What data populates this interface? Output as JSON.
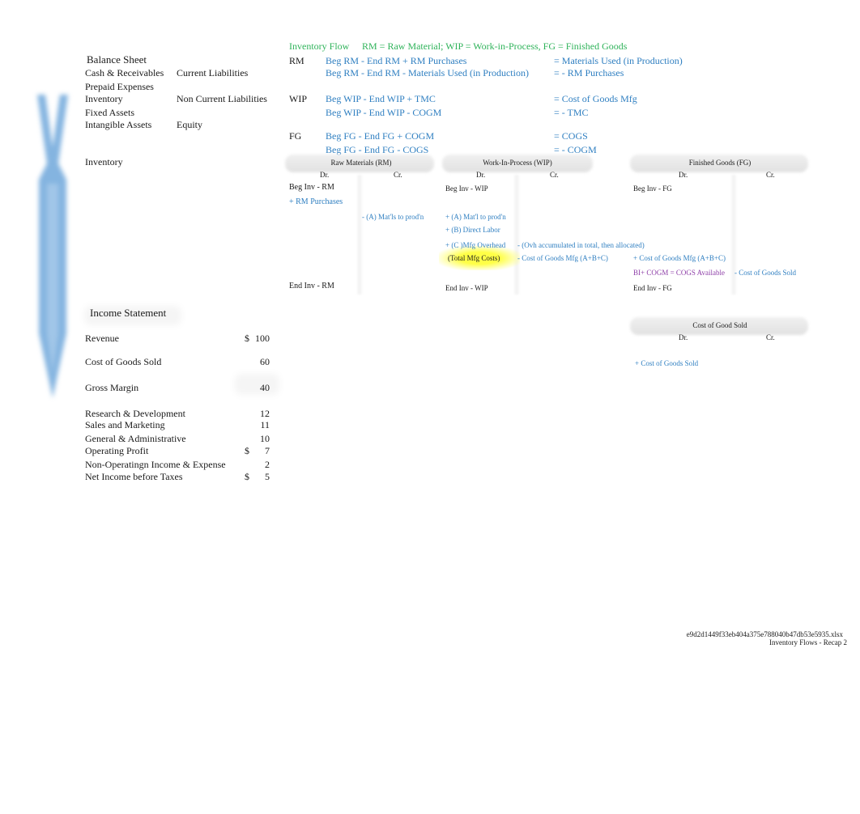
{
  "balance_sheet": {
    "title": "Balance Sheet",
    "assets": [
      "Cash & Receivables",
      "Prepaid Expenses",
      "Inventory",
      "Fixed Assets",
      "Intangible Assets"
    ],
    "liabilities": [
      "Current Liabilities",
      "Non Current Liabilities",
      "Equity"
    ],
    "inventory_label": "Inventory"
  },
  "inventory_flow": {
    "title": "Inventory Flow",
    "legend": "RM = Raw Material; WIP = Work-in-Process, FG = Finished Goods",
    "rows": [
      {
        "label": "RM",
        "formula": "Beg RM - End RM + RM Purchases",
        "result": "= Materials Used (in Production)"
      },
      {
        "label": "",
        "formula": "Beg RM - End RM - Materials Used (in Production)",
        "result": "= - RM Purchases"
      },
      {
        "label": "WIP",
        "formula": "Beg WIP - End WIP + TMC",
        "result": "= Cost of Goods Mfg"
      },
      {
        "label": "",
        "formula": "Beg WIP - End WIP - COGM",
        "result": "= - TMC"
      },
      {
        "label": "FG",
        "formula": "Beg FG - End FG + COGM",
        "result": "= COGS"
      },
      {
        "label": "",
        "formula": "Beg FG - End FG - COGS",
        "result": "= - COGM"
      }
    ]
  },
  "t_accounts": {
    "rm": {
      "title": "Raw Materials (RM)",
      "dr": "Dr.",
      "cr": "Cr.",
      "beg": "Beg Inv - RM",
      "purchases": "+ RM Purchases",
      "credit": "- (A) Mat'ls to prod'n",
      "end": "End Inv - RM"
    },
    "wip": {
      "title": "Work-In-Process (WIP)",
      "dr": "Dr.",
      "cr": "Cr.",
      "beg": "Beg Inv - WIP",
      "a": "+ (A) Mat'l to prod'n",
      "b": "+ (B) Direct Labor",
      "c": "+ (C )Mfg Overhead",
      "ovh_note": "- (Ovh accumulated in total, then allocated)",
      "total": "(Total Mfg Costs)",
      "credit": "- Cost of Goods Mfg (A+B+C)",
      "end": "End Inv - WIP"
    },
    "fg": {
      "title": "Finished Goods (FG)",
      "dr": "Dr.",
      "cr": "Cr.",
      "beg": "Beg Inv - FG",
      "debit": "+ Cost of Goods Mfg (A+B+C)",
      "available": "BI+ COGM = COGS Available",
      "credit": "- Cost of Goods Sold",
      "end": "End Inv - FG"
    },
    "cogs": {
      "title": "Cost of Good Sold",
      "dr": "Dr.",
      "cr": "Cr.",
      "debit": "+ Cost of Goods Sold"
    }
  },
  "income_statement": {
    "title": "Income Statement",
    "rows": [
      {
        "label": "Revenue",
        "currency": "$",
        "value": "100"
      },
      {
        "label": "Cost of Goods Sold",
        "currency": "",
        "value": "60"
      },
      {
        "label": "Gross Margin",
        "currency": "",
        "value": "40"
      },
      {
        "label": "Research & Development",
        "currency": "",
        "value": "12"
      },
      {
        "label": "Sales and Marketing",
        "currency": "",
        "value": "11"
      },
      {
        "label": "General & Administrative",
        "currency": "",
        "value": "10"
      },
      {
        "label": "Operating Profit",
        "currency": "$",
        "value": "7"
      },
      {
        "label": "Non-Operatingn Income & Expense",
        "currency": "",
        "value": "2"
      },
      {
        "label": "Net Income before Taxes",
        "currency": "$",
        "value": "5"
      }
    ]
  },
  "footer": {
    "filename": "e9d2d1449f33eb404a375e788040b47db53e5935.xlsx",
    "sheet": "Inventory Flows - Recap 2"
  }
}
